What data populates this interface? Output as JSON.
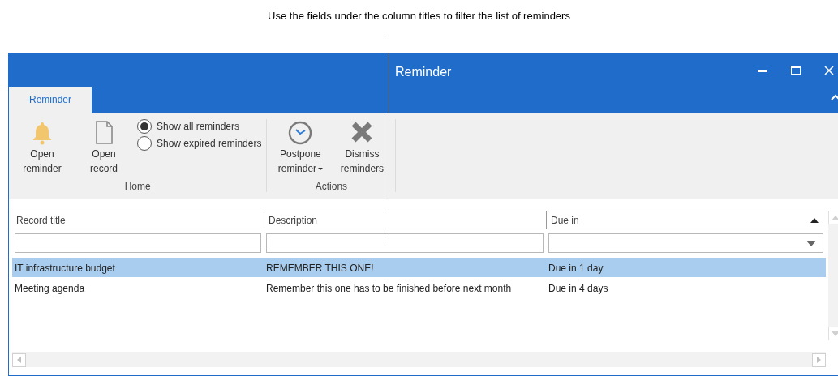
{
  "callout": {
    "text": "Use the fields under the column titles to filter the list of reminders"
  },
  "window": {
    "title": "Reminder"
  },
  "ribbon": {
    "tabs": [
      {
        "label": "Reminder",
        "selected": true
      }
    ],
    "groups": [
      {
        "label": "Home",
        "items": [
          {
            "kind": "bell",
            "label": "Open reminder"
          },
          {
            "kind": "page",
            "label": "Open record"
          },
          {
            "kind": "radios",
            "options": [
              {
                "label": "Show all reminders",
                "selected": true
              },
              {
                "label": "Show expired reminders",
                "selected": false
              }
            ]
          }
        ]
      },
      {
        "label": "Actions",
        "items": [
          {
            "kind": "clock",
            "label": "Postpone reminder",
            "dropdown": true
          },
          {
            "kind": "cross",
            "label": "Dismiss reminders"
          }
        ]
      }
    ]
  },
  "grid": {
    "columns": [
      {
        "label": "Record title",
        "kind": "text",
        "sorted": false
      },
      {
        "label": "Description",
        "kind": "text",
        "sorted": false
      },
      {
        "label": "Due in",
        "kind": "dropdown",
        "sorted": true
      }
    ],
    "rows": [
      {
        "selected": true,
        "cells": [
          "IT infrastructure budget",
          "REMEMBER THIS ONE!",
          "Due in 1 day"
        ]
      },
      {
        "selected": false,
        "cells": [
          "Meeting agenda",
          "Remember this one has to be finished before next month",
          "Due in 4 days"
        ]
      }
    ]
  }
}
